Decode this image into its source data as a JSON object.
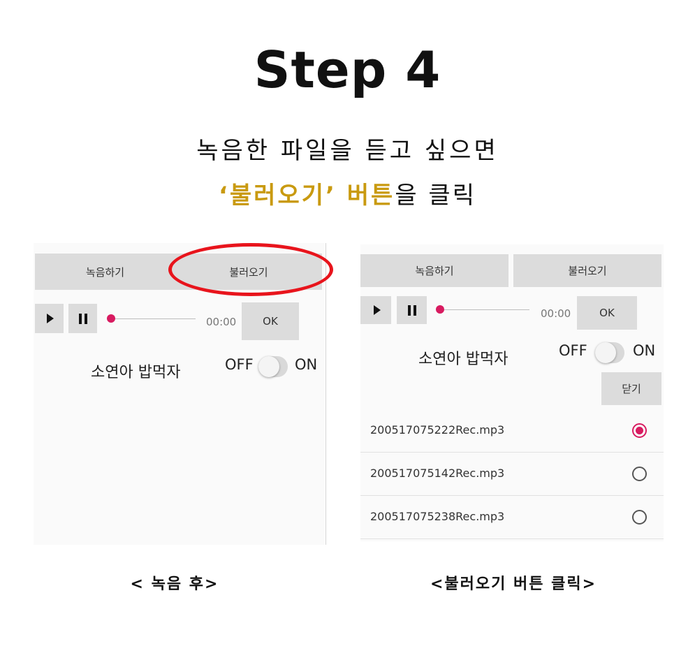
{
  "title": "Step 4",
  "subtitle_line1": "녹음한 파일을 듣고 싶으면",
  "subtitle_line2_highlight": "‘불러오기’ 버튼",
  "subtitle_line2_rest": "을 클릭",
  "colors": {
    "highlight": "#c99a10",
    "accent_pink": "#d81b60",
    "ellipse_red": "#e8141c"
  },
  "left_panel": {
    "record_button": "녹음하기",
    "load_button": "불러오기",
    "time": "00:00",
    "ok_button": "OK",
    "name": "소연아 밥먹자",
    "switch_off": "OFF",
    "switch_on": "ON",
    "caption": "< 녹음 후>"
  },
  "right_panel": {
    "record_button": "녹음하기",
    "load_button": "불러오기",
    "time": "00:00",
    "ok_button": "OK",
    "name": "소연아 밥먹자",
    "switch_off": "OFF",
    "switch_on": "ON",
    "close_button": "닫기",
    "files": [
      {
        "name": "200517075222Rec.mp3",
        "selected": true
      },
      {
        "name": "200517075142Rec.mp3",
        "selected": false
      },
      {
        "name": "200517075238Rec.mp3",
        "selected": false
      }
    ],
    "caption": "<불러오기 버튼 클릭>"
  },
  "icons": [
    "play-icon",
    "pause-icon",
    "seek-thumb-icon",
    "radio-checked-icon",
    "radio-unchecked-icon"
  ]
}
